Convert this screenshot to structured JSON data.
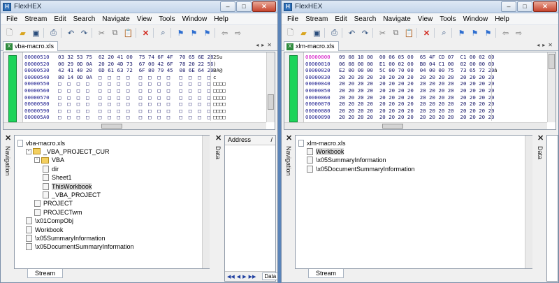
{
  "windows": [
    {
      "title": "FlexHEX",
      "menu": [
        "File",
        "Stream",
        "Edit",
        "Search",
        "Navigate",
        "View",
        "Tools",
        "Window",
        "Help"
      ],
      "doc_tab": "vba-macro.xls",
      "hex_rows": [
        {
          "addr": "00000510",
          "bytes": "03 32 53 75  62 20 41 00  75 74 6F 4F  70 65 6E 28",
          "ascii": "2Su"
        },
        {
          "addr": "00000520",
          "bytes": "00 29 0D 0A  20 20 4D 73  67 00 42 6F  78 20 22 56",
          "ascii": ")"
        },
        {
          "addr": "00000530",
          "bytes": "42 41 40 20  6D 61 63 72  6F 80 79 45  08 6E 64 20",
          "ascii": "BA@"
        },
        {
          "addr": "00000540",
          "bytes": "80 14 0D 0A  □  □  □  □   □  □  □  □   □  □  □  □",
          "ascii": "c"
        },
        {
          "addr": "00000550",
          "bytes": "□  □  □  □   □  □  □  □   □  □  □  □   □  □  □  □",
          "ascii": "□□□□"
        },
        {
          "addr": "00000560",
          "bytes": "□  □  □  □   □  □  □  □   □  □  □  □   □  □  □  □",
          "ascii": "□□□□"
        },
        {
          "addr": "00000570",
          "bytes": "□  □  □  □   □  □  □  □   □  □  □  □   □  □  □  □",
          "ascii": "□□□□"
        },
        {
          "addr": "00000580",
          "bytes": "□  □  □  □   □  □  □  □   □  □  □  □   □  □  □  □",
          "ascii": "□□□□"
        },
        {
          "addr": "00000590",
          "bytes": "□  □  □  □   □  □  □  □   □  □  □  □   □  □  □  □",
          "ascii": "□□□□"
        },
        {
          "addr": "000005A0",
          "bytes": "□  □  □  □   □  □  □  □   □  □  □  □   □  □  □  □",
          "ascii": "□□□□"
        }
      ],
      "nav_label": "Navigation",
      "data_label": "Data",
      "tree": [
        {
          "label": "vba-macro.xls",
          "type": "file",
          "level": 0
        },
        {
          "label": "_VBA_PROJECT_CUR",
          "type": "folder",
          "level": 1,
          "expand": "-"
        },
        {
          "label": "VBA",
          "type": "folder",
          "level": 2,
          "expand": "-"
        },
        {
          "label": "dir",
          "type": "node",
          "level": 3
        },
        {
          "label": "Sheet1",
          "type": "node",
          "level": 3
        },
        {
          "label": "ThisWorkbook",
          "type": "node",
          "level": 3,
          "selected": true
        },
        {
          "label": "_VBA_PROJECT",
          "type": "node",
          "level": 3
        },
        {
          "label": "PROJECT",
          "type": "node",
          "level": 2
        },
        {
          "label": "PROJECTwm",
          "type": "node",
          "level": 2
        },
        {
          "label": "\\x01CompObj",
          "type": "node",
          "level": 1
        },
        {
          "label": "Workbook",
          "type": "node",
          "level": 1
        },
        {
          "label": "\\x05SummaryInformation",
          "type": "node",
          "level": 1
        },
        {
          "label": "\\x05DocumentSummaryInformation",
          "type": "node",
          "level": 1
        }
      ],
      "bottom_tab": "Stream",
      "data_panel": {
        "header": "Address",
        "slash": "/",
        "tab": "Data"
      }
    },
    {
      "title": "FlexHEX",
      "menu": [
        "File",
        "Stream",
        "Edit",
        "Search",
        "Navigate",
        "View",
        "Tools",
        "Window",
        "Help"
      ],
      "doc_tab": "xlm-macro.xls",
      "hex_rows": [
        {
          "addr": "00000000",
          "bytes": "09 08 10 00  00 06 05 00  65 4F CD 07  C1 00 02 00",
          "ascii": "",
          "hl": true
        },
        {
          "addr": "00000010",
          "bytes": "06 08 00 00  E1 00 02 00  B0 04 C1 00  02 00 00 00",
          "ascii": ""
        },
        {
          "addr": "00000020",
          "bytes": "E2 00 00 00  5C 00 70 00  04 00 00 75  73 65 72 20",
          "ascii": "â"
        },
        {
          "addr": "00000030",
          "bytes": "20 20 20 20  20 20 20 20  20 20 20 20  20 20 20 20",
          "ascii": ""
        },
        {
          "addr": "00000040",
          "bytes": "20 20 20 20  20 20 20 20  20 20 20 20  20 20 20 20",
          "ascii": ""
        },
        {
          "addr": "00000050",
          "bytes": "20 20 20 20  20 20 20 20  20 20 20 20  20 20 20 20",
          "ascii": ""
        },
        {
          "addr": "00000060",
          "bytes": "20 20 20 20  20 20 20 20  20 20 20 20  20 20 20 20",
          "ascii": ""
        },
        {
          "addr": "00000070",
          "bytes": "20 20 20 20  20 20 20 20  20 20 20 20  20 20 20 20",
          "ascii": ""
        },
        {
          "addr": "00000080",
          "bytes": "20 20 20 20  20 20 20 20  20 20 20 20  20 20 20 20",
          "ascii": ""
        },
        {
          "addr": "00000090",
          "bytes": "20 20 20 20  20 20 20 20  20 20 20 20  20 20 20 20",
          "ascii": ""
        }
      ],
      "nav_label": "Navigation",
      "data_label": "Data",
      "tree": [
        {
          "label": "xlm-macro.xls",
          "type": "file",
          "level": 0
        },
        {
          "label": "Workbook",
          "type": "node",
          "level": 1,
          "selected": true
        },
        {
          "label": "\\x05SummaryInformation",
          "type": "node",
          "level": 1
        },
        {
          "label": "\\x05DocumentSummaryInformation",
          "type": "node",
          "level": 1
        }
      ],
      "bottom_tab": "Stream"
    }
  ],
  "caption_buttons": {
    "minimize": "–",
    "maximize": "□",
    "close": "✕"
  },
  "toolbar_icons": [
    "new-doc-icon",
    "open-folder-icon",
    "save-icon",
    "print-icon",
    "undo-icon",
    "redo-icon",
    "cut-icon",
    "copy-icon",
    "paste-icon",
    "delete-icon",
    "find-icon",
    "bookmark-flag-icon",
    "bookmark-prev-icon",
    "bookmark-next-icon",
    "back-arrow-icon",
    "forward-arrow-icon"
  ],
  "colors": {
    "accent_green": "#1dd45a",
    "address_highlight": "#d000c0"
  }
}
